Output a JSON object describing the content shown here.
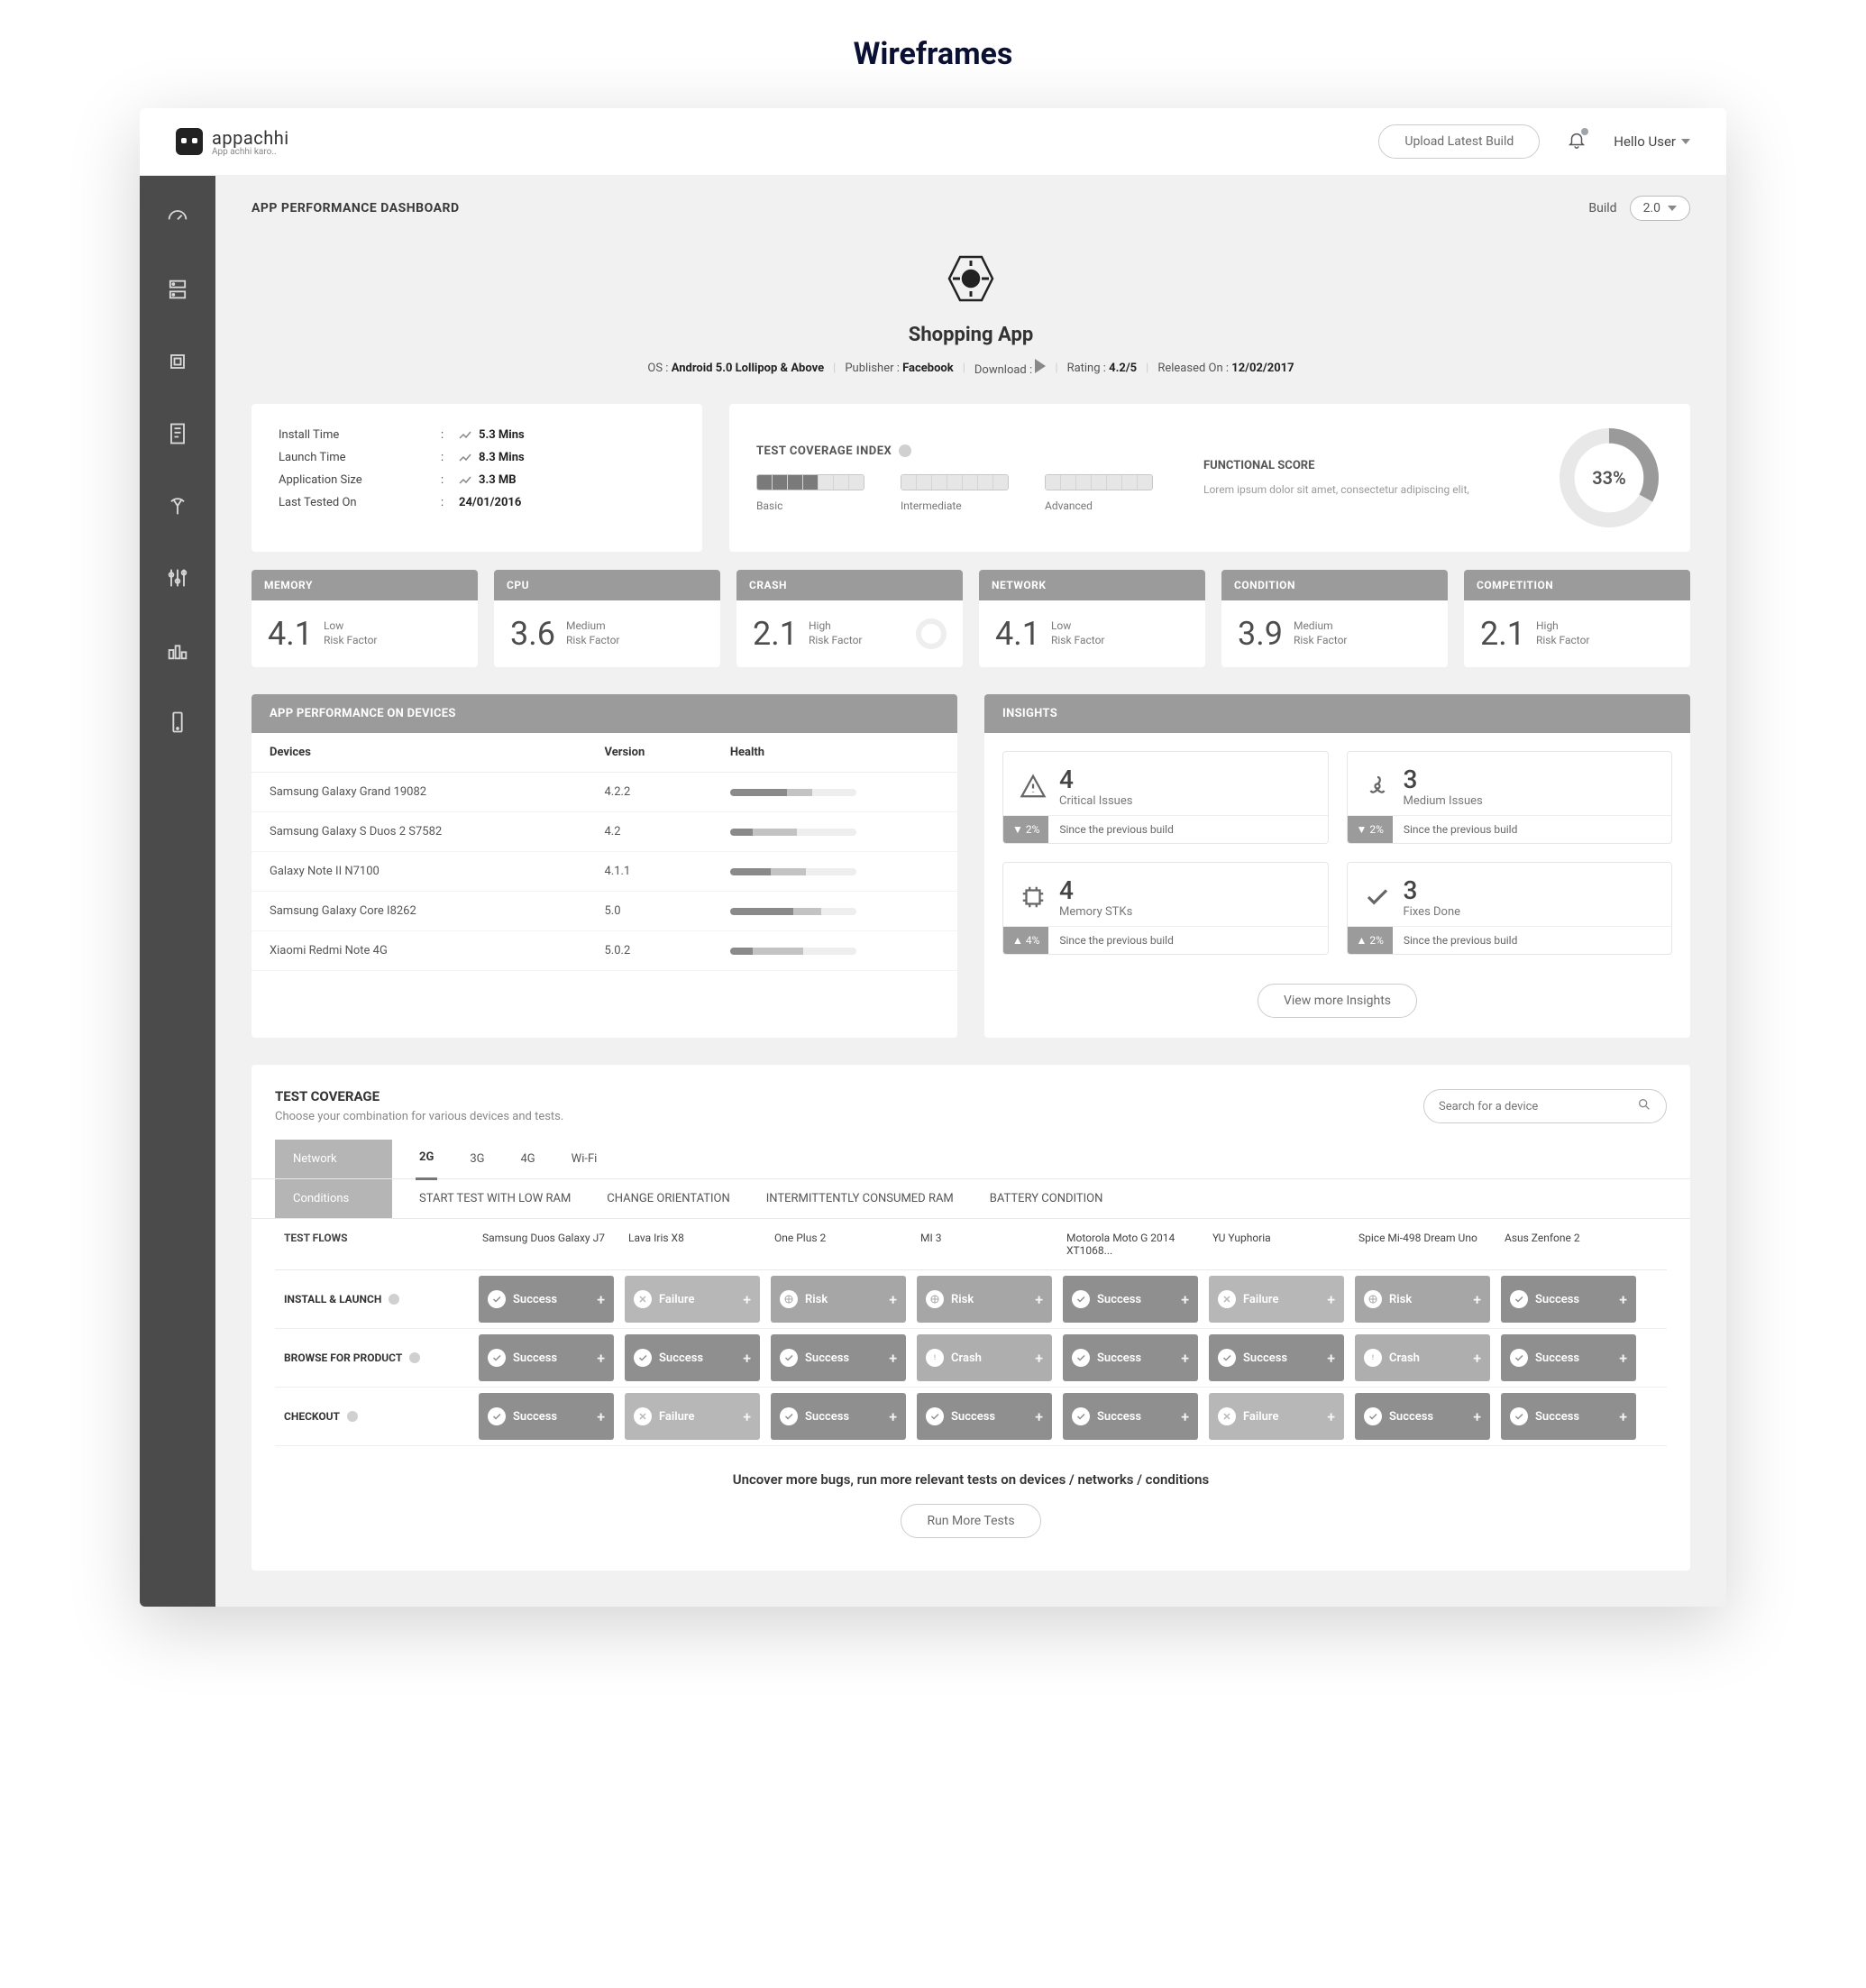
{
  "page_label": "Wireframes",
  "brand": {
    "name": "appachhi",
    "tagline": "App achhi karo.."
  },
  "topbar": {
    "upload_btn": "Upload Latest Build",
    "greeting": "Hello User"
  },
  "header": {
    "title": "APP PERFORMANCE DASHBOARD",
    "build_label": "Build",
    "build_value": "2.0"
  },
  "app": {
    "name": "Shopping App",
    "meta": {
      "os_label": "OS :",
      "os_value": "Android 5.0 Lollipop & Above",
      "publisher_label": "Publisher :",
      "publisher_value": "Facebook",
      "download_label": "Download :",
      "rating_label": "Rating :",
      "rating_value": "4.2/5",
      "released_label": "Released On :",
      "released_value": "12/02/2017"
    }
  },
  "info": [
    {
      "k": "Install Time",
      "v": "5.3 Mins",
      "trend": true
    },
    {
      "k": "Launch Time",
      "v": "8.3 Mins",
      "trend": true
    },
    {
      "k": "Application Size",
      "v": "3.3 MB",
      "trend": true
    },
    {
      "k": "Last Tested On",
      "v": "24/01/2016",
      "trend": false
    }
  ],
  "coverage": {
    "title": "TEST COVERAGE INDEX",
    "levels": [
      "Basic",
      "Intermediate",
      "Advanced"
    ],
    "fill": [
      4,
      0,
      0
    ]
  },
  "functional": {
    "title": "FUNCTIONAL SCORE",
    "desc": "Lorem ipsum dolor sit amet, consectetur adipiscing elit,",
    "value": "33%"
  },
  "metrics": [
    {
      "name": "MEMORY",
      "value": "4.1",
      "risk": "Low",
      "sub": "Risk Factor"
    },
    {
      "name": "CPU",
      "value": "3.6",
      "risk": "Medium",
      "sub": "Risk Factor"
    },
    {
      "name": "CRASH",
      "value": "2.1",
      "risk": "High",
      "sub": "Risk Factor",
      "halo": true
    },
    {
      "name": "NETWORK",
      "value": "4.1",
      "risk": "Low",
      "sub": "Risk Factor"
    },
    {
      "name": "CONDITION",
      "value": "3.9",
      "risk": "Medium",
      "sub": "Risk Factor"
    },
    {
      "name": "COMPETITION",
      "value": "2.1",
      "risk": "High",
      "sub": "Risk Factor"
    }
  ],
  "devices_panel": {
    "title": "APP PERFORMANCE ON DEVICES",
    "cols": [
      "Devices",
      "Version",
      "Health"
    ],
    "rows": [
      {
        "dev": "Samsung Galaxy Grand 19082",
        "ver": "4.2.2",
        "h": [
          45,
          20
        ]
      },
      {
        "dev": "Samsung Galaxy S Duos 2 S7582",
        "ver": "4.2",
        "h": [
          18,
          35
        ]
      },
      {
        "dev": "Galaxy Note II N7100",
        "ver": "4.1.1",
        "h": [
          32,
          28
        ]
      },
      {
        "dev": "Samsung Galaxy Core I8262",
        "ver": "5.0",
        "h": [
          50,
          22
        ]
      },
      {
        "dev": "Xiaomi Redmi Note 4G",
        "ver": "5.0.2",
        "h": [
          18,
          40
        ]
      }
    ]
  },
  "insights_panel": {
    "title": "INSIGHTS",
    "items": [
      {
        "icon": "warning",
        "num": "4",
        "lbl": "Critical Issues",
        "pct": "2%",
        "dir": "down",
        "note": "Since the previous build"
      },
      {
        "icon": "fan",
        "num": "3",
        "lbl": "Medium Issues",
        "pct": "2%",
        "dir": "down",
        "note": "Since the previous build"
      },
      {
        "icon": "chip",
        "num": "4",
        "lbl": "Memory STKs",
        "pct": "4%",
        "dir": "up",
        "note": "Since the previous build"
      },
      {
        "icon": "check",
        "num": "3",
        "lbl": "Fixes Done",
        "pct": "2%",
        "dir": "up",
        "note": "Since the previous build"
      }
    ],
    "more": "View more Insights"
  },
  "tc": {
    "title": "TEST COVERAGE",
    "sub": "Choose your combination for various devices and tests.",
    "search_ph": "Search for a device",
    "network_label": "Network",
    "network_opts": [
      "2G",
      "3G",
      "4G",
      "Wi-Fi"
    ],
    "conditions_label": "Conditions",
    "conditions_opts": [
      "START TEST WITH LOW RAM",
      "CHANGE ORIENTATION",
      "INTERMITTENTLY CONSUMED RAM",
      "BATTERY CONDITION"
    ],
    "flows_label": "TEST FLOWS",
    "devices": [
      "Samsung Duos Galaxy J7",
      "Lava Iris X8",
      "One Plus 2",
      "MI 3",
      "Motorola Moto G 2014 XT1068...",
      "YU Yuphoria",
      "Spice Mi-498 Dream Uno",
      "Asus Zenfone 2"
    ],
    "flows": [
      {
        "name": "INSTALL & LAUNCH",
        "cells": [
          "Success",
          "Failure",
          "Risk",
          "Risk",
          "Success",
          "Failure",
          "Risk",
          "Success"
        ]
      },
      {
        "name": "BROWSE FOR PRODUCT",
        "cells": [
          "Success",
          "Success",
          "Success",
          "Crash",
          "Success",
          "Success",
          "Crash",
          "Success"
        ]
      },
      {
        "name": "CHECKOUT",
        "cells": [
          "Success",
          "Failure",
          "Success",
          "Success",
          "Success",
          "Failure",
          "Success",
          "Success"
        ]
      }
    ],
    "footer_text": "Uncover more bugs, run more relevant tests on devices / networks / conditions",
    "footer_btn": "Run More Tests"
  }
}
